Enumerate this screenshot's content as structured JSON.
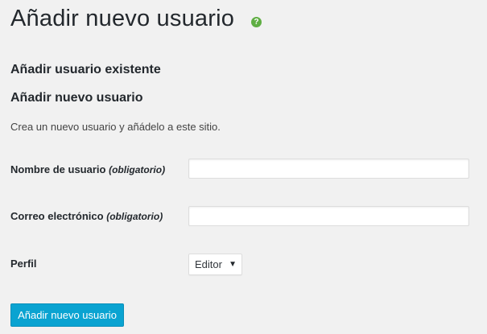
{
  "header": {
    "title": "Añadir nuevo usuario",
    "help_icon": "question-mark-icon",
    "help_icon_color": "#5fae43"
  },
  "sections": {
    "add_existing": "Añadir usuario existente",
    "add_new": "Añadir nuevo usuario",
    "description": "Crea un nuevo usuario y añádelo a este sitio."
  },
  "form": {
    "username": {
      "label": "Nombre de usuario",
      "required": "(obligatorio)",
      "value": ""
    },
    "email": {
      "label": "Correo electrónico",
      "required": "(obligatorio)",
      "value": ""
    },
    "role": {
      "label": "Perfil",
      "selected": "Editor",
      "arrow": "▼"
    },
    "submit_label": "Añadir nuevo usuario",
    "button_color": "#0aa3d1"
  }
}
